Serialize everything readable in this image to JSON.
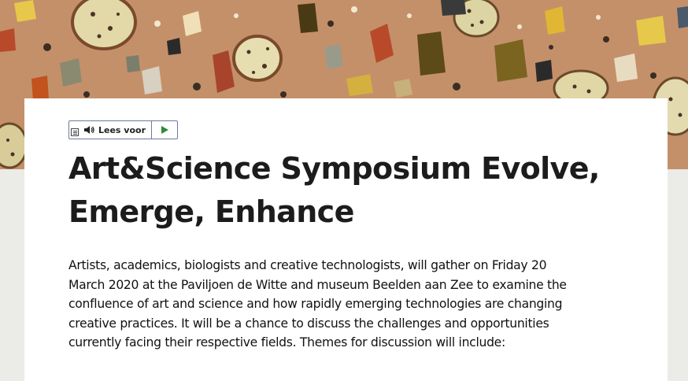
{
  "readspeaker": {
    "listen_label": "Lees voor",
    "menu_icon": "menu-icon",
    "speaker_icon": "speaker-icon",
    "play_icon": "play-icon",
    "play_color": "#2e8b3a"
  },
  "article": {
    "title": "Art&Science Symposium Evolve, Emerge, Enhance",
    "intro": "Artists, academics, biologists and creative technologists, will gather on Friday 20 March 2020 at the Paviljoen de Witte and museum Beelden aan Zee to examine the confluence of art and science and how rapidly emerging technologies are changing creative practices. It will be a chance to discuss the challenges and opportunities currently facing their respective fields. Themes for discussion will include:"
  }
}
